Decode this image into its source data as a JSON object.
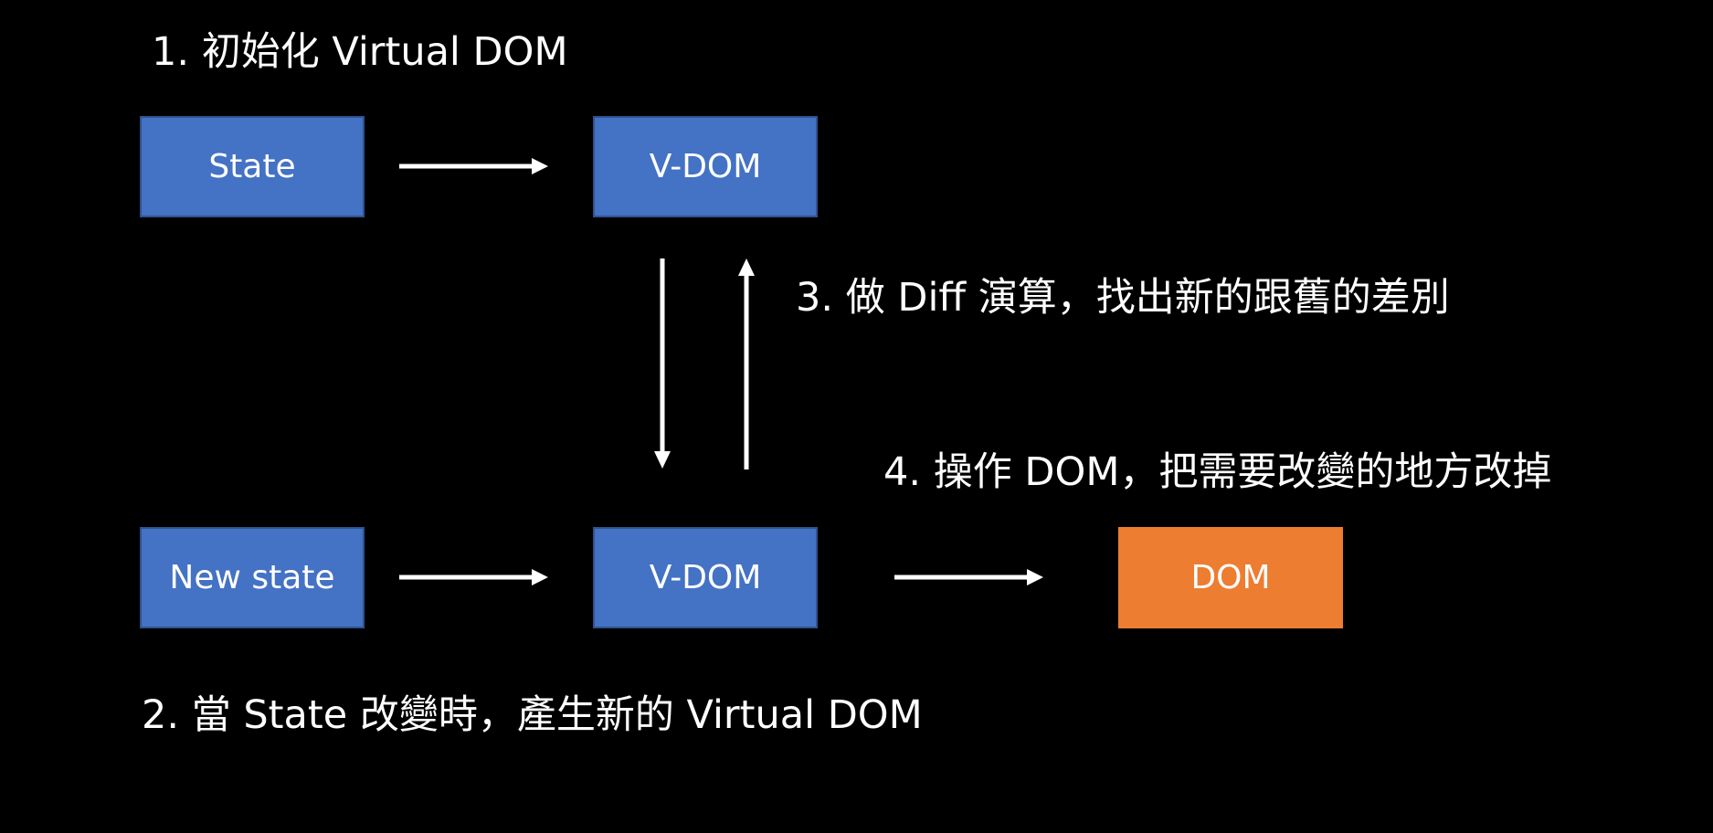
{
  "steps": {
    "step1": "1. 初始化 Virtual DOM",
    "step2": "2. 當 State 改變時，產生新的 Virtual DOM",
    "step3": "3. 做 Diff 演算，找出新的跟舊的差別",
    "step4": "4. 操作 DOM，把需要改變的地方改掉"
  },
  "boxes": {
    "state": "State",
    "vdom_top": "V-DOM",
    "new_state": "New state",
    "vdom_bottom": "V-DOM",
    "dom": "DOM"
  },
  "colors": {
    "background": "#000000",
    "box_blue": "#4472c4",
    "box_orange": "#ed7d31",
    "text": "#ffffff"
  }
}
